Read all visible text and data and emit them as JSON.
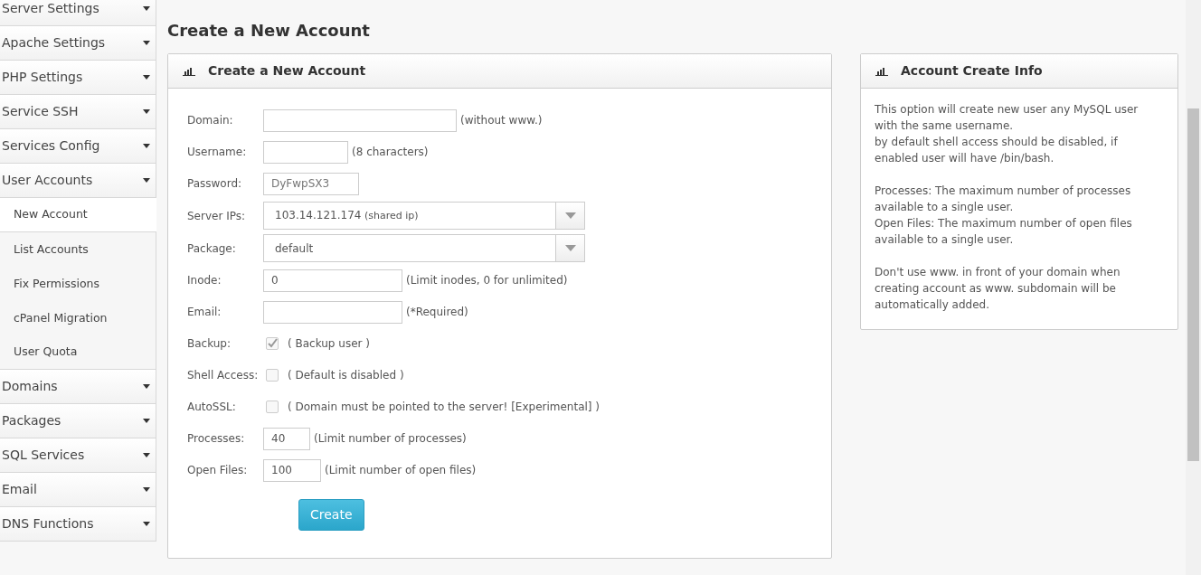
{
  "sidebar": {
    "items": [
      {
        "label": "Server Settings"
      },
      {
        "label": "Apache Settings"
      },
      {
        "label": "PHP Settings"
      },
      {
        "label": "Service SSH"
      },
      {
        "label": "Services Config"
      },
      {
        "label": "User Accounts",
        "children": [
          {
            "label": "New Account",
            "selected": true
          },
          {
            "label": "List Accounts",
            "selected": false
          },
          {
            "label": "Fix Permissions",
            "selected": false
          },
          {
            "label": "cPanel Migration",
            "selected": false
          },
          {
            "label": "User Quota",
            "selected": false
          }
        ]
      },
      {
        "label": "Domains"
      },
      {
        "label": "Packages"
      },
      {
        "label": "SQL Services"
      },
      {
        "label": "Email"
      },
      {
        "label": "DNS Functions"
      }
    ]
  },
  "page_title": "Create a New Account",
  "form_panel": {
    "title": "Create a New Account",
    "fields": [
      {
        "kind": "text",
        "label": "Domain:",
        "hint": "(without www.)"
      },
      {
        "kind": "text",
        "label": "Username:",
        "hint": "(8 characters)"
      },
      {
        "kind": "readonly",
        "label": "Password:",
        "value": "DyFwpSX3"
      },
      {
        "kind": "select",
        "label": "Server IPs:",
        "value": "103.14.121.174",
        "note": "(shared ip)"
      },
      {
        "kind": "select",
        "label": "Package:",
        "value": "default"
      },
      {
        "kind": "text",
        "label": "Inode:",
        "value": "0",
        "hint": "(Limit inodes, 0 for unlimited)"
      },
      {
        "kind": "text",
        "label": "Email:",
        "hint": "(*Required)"
      },
      {
        "kind": "checkbox",
        "label": "Backup:",
        "checked": true,
        "hint": "( Backup user )"
      },
      {
        "kind": "checkbox",
        "label": "Shell Access:",
        "checked": false,
        "hint": "( Default is disabled )"
      },
      {
        "kind": "checkbox",
        "label": "AutoSSL:",
        "checked": false,
        "hint": "( Domain must be pointed to the server! [Experimental] )"
      },
      {
        "kind": "text",
        "label": "Processes:",
        "value": "40",
        "hint": "(Limit number of processes)"
      },
      {
        "kind": "text",
        "label": "Open Files:",
        "value": "100",
        "hint": "(Limit number of open files)"
      }
    ],
    "submit": "Create"
  },
  "info_panel": {
    "title": "Account Create Info",
    "paragraphs": [
      [
        "This option will create new user any MySQL user with the same username.",
        "by default shell access should be disabled, if enabled user will have /bin/bash."
      ],
      [
        "Processes: The maximum number of processes available to a single user.",
        "Open Files: The maximum number of open files available to a single user."
      ],
      [
        "Don't use www. in front of your domain when creating account as www. subdomain will be automatically added."
      ]
    ]
  }
}
